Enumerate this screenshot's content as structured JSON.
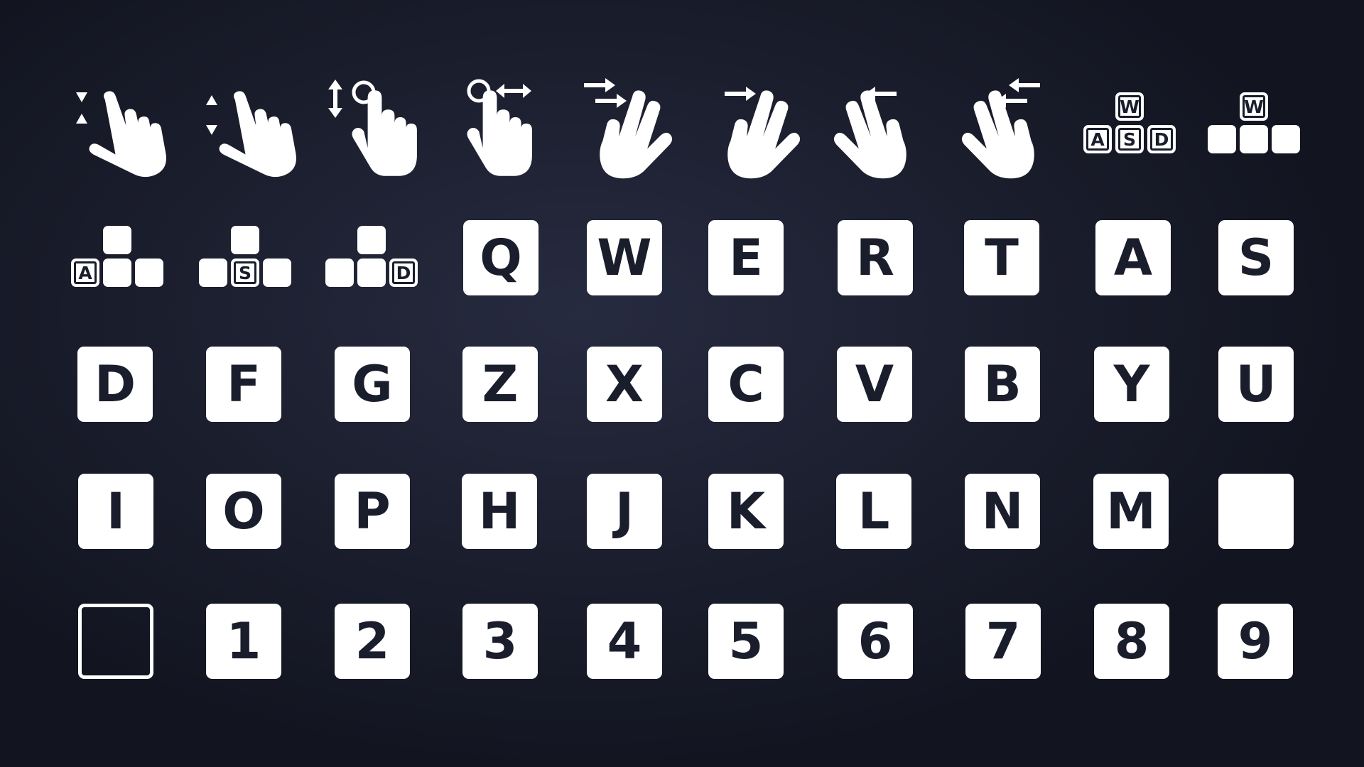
{
  "colors": {
    "background": "#1b1e2d",
    "glyph": "#ffffff",
    "key_text": "#1a1d2b"
  },
  "gesture_icons": [
    "tap-scroll-down-hand-icon",
    "tap-scroll-up-hand-icon",
    "vertical-drag-hand-icon",
    "horizontal-drag-hand-icon",
    "two-finger-swipe-right-hand-icon",
    "swipe-right-hand-icon",
    "swipe-left-hand-icon",
    "two-finger-swipe-left-hand-icon"
  ],
  "clusters": {
    "wasd": {
      "top": "W",
      "left": "A",
      "middle": "S",
      "right": "D"
    },
    "w_only": {
      "top": "W"
    },
    "a_only": {
      "left": "A"
    },
    "s_only": {
      "middle": "S"
    },
    "d_only": {
      "right": "D"
    }
  },
  "keys": {
    "row2": [
      "Q",
      "W",
      "E",
      "R",
      "T",
      "A",
      "S"
    ],
    "row3": [
      "D",
      "F",
      "G",
      "Z",
      "X",
      "C",
      "V",
      "B",
      "Y",
      "U"
    ],
    "row4": [
      "I",
      "O",
      "P",
      "H",
      "J",
      "K",
      "L",
      "N",
      "M",
      ""
    ],
    "row5_numbers": [
      "1",
      "2",
      "3",
      "4",
      "5",
      "6",
      "7",
      "8",
      "9"
    ]
  }
}
